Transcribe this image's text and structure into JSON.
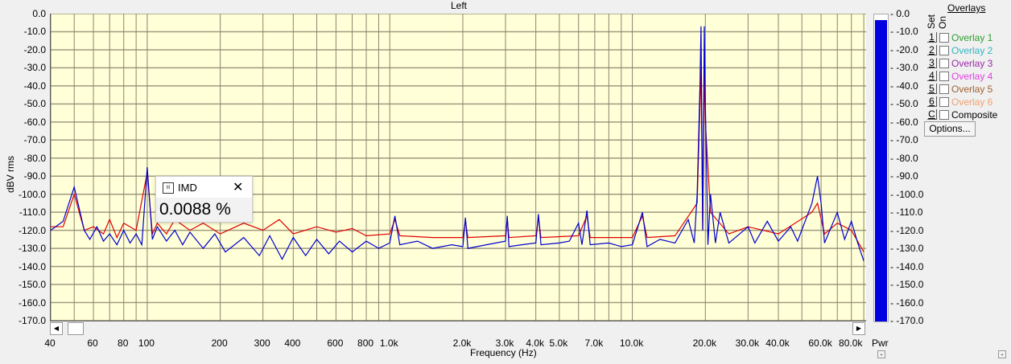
{
  "window": {
    "title": "Left"
  },
  "chart_data": {
    "type": "line",
    "title": "Left",
    "xlabel": "Frequency (Hz)",
    "ylabel": "dBV rms",
    "xscale": "log",
    "xlim": [
      40,
      92000
    ],
    "ylim": [
      -170,
      0
    ],
    "grid": true,
    "background": "#ffffd8",
    "yticks": [
      "0.0",
      "-10.0",
      "-20.0",
      "-30.0",
      "-40.0",
      "-50.0",
      "-60.0",
      "-70.0",
      "-80.0",
      "-90.0",
      "-100.0",
      "-110.0",
      "-120.0",
      "-130.0",
      "-140.0",
      "-150.0",
      "-160.0",
      "-170.0"
    ],
    "xticks": [
      {
        "v": 40,
        "l": "40"
      },
      {
        "v": 60,
        "l": "60"
      },
      {
        "v": 80,
        "l": "80"
      },
      {
        "v": 100,
        "l": "100"
      },
      {
        "v": 200,
        "l": "200"
      },
      {
        "v": 300,
        "l": "300"
      },
      {
        "v": 400,
        "l": "400"
      },
      {
        "v": 600,
        "l": "600"
      },
      {
        "v": 800,
        "l": "800"
      },
      {
        "v": 1000,
        "l": "1.0k"
      },
      {
        "v": 2000,
        "l": "2.0k"
      },
      {
        "v": 3000,
        "l": "3.0k"
      },
      {
        "v": 4000,
        "l": "4.0k"
      },
      {
        "v": 5000,
        "l": "5.0k"
      },
      {
        "v": 7000,
        "l": "7.0k"
      },
      {
        "v": 10000,
        "l": "10.0k"
      },
      {
        "v": 20000,
        "l": "20.0k"
      },
      {
        "v": 30000,
        "l": "30.0k"
      },
      {
        "v": 40000,
        "l": "40.0k"
      },
      {
        "v": 60000,
        "l": "60.0k"
      },
      {
        "v": 80000,
        "l": "80.0k"
      }
    ],
    "series": [
      {
        "color": "#e00000",
        "points": [
          [
            40,
            -118
          ],
          [
            45,
            -118
          ],
          [
            50,
            -100
          ],
          [
            55,
            -120
          ],
          [
            60,
            -118
          ],
          [
            66,
            -122
          ],
          [
            70,
            -114
          ],
          [
            75,
            -124
          ],
          [
            80,
            -116
          ],
          [
            90,
            -120
          ],
          [
            100,
            -88
          ],
          [
            105,
            -122
          ],
          [
            110,
            -116
          ],
          [
            120,
            -122
          ],
          [
            130,
            -114
          ],
          [
            150,
            -120
          ],
          [
            170,
            -116
          ],
          [
            200,
            -122
          ],
          [
            250,
            -116
          ],
          [
            300,
            -120
          ],
          [
            350,
            -114
          ],
          [
            400,
            -122
          ],
          [
            500,
            -118
          ],
          [
            600,
            -121
          ],
          [
            700,
            -119
          ],
          [
            800,
            -123
          ],
          [
            1000,
            -122
          ],
          [
            1050,
            -114
          ],
          [
            1100,
            -123
          ],
          [
            1500,
            -124
          ],
          [
            2000,
            -124
          ],
          [
            2050,
            -115
          ],
          [
            2100,
            -124
          ],
          [
            3000,
            -123
          ],
          [
            3050,
            -114
          ],
          [
            3100,
            -124
          ],
          [
            4000,
            -123
          ],
          [
            4100,
            -113
          ],
          [
            4200,
            -124
          ],
          [
            6000,
            -123
          ],
          [
            6500,
            -112
          ],
          [
            6700,
            -124
          ],
          [
            10000,
            -124
          ],
          [
            11000,
            -112
          ],
          [
            11500,
            -124
          ],
          [
            15000,
            -123
          ],
          [
            18500,
            -105
          ],
          [
            19200,
            -30
          ],
          [
            19500,
            -120
          ],
          [
            19800,
            -30
          ],
          [
            20000,
            -60
          ],
          [
            21000,
            -110
          ],
          [
            25000,
            -122
          ],
          [
            30000,
            -118
          ],
          [
            40000,
            -122
          ],
          [
            55000,
            -110
          ],
          [
            58000,
            -105
          ],
          [
            62000,
            -122
          ],
          [
            70000,
            -116
          ],
          [
            80000,
            -120
          ],
          [
            90000,
            -132
          ]
        ]
      },
      {
        "color": "#0000d0",
        "points": [
          [
            40,
            -120
          ],
          [
            45,
            -115
          ],
          [
            50,
            -96
          ],
          [
            55,
            -120
          ],
          [
            58,
            -125
          ],
          [
            62,
            -118
          ],
          [
            66,
            -126
          ],
          [
            70,
            -122
          ],
          [
            75,
            -128
          ],
          [
            80,
            -120
          ],
          [
            85,
            -127
          ],
          [
            90,
            -122
          ],
          [
            95,
            -128
          ],
          [
            100,
            -85
          ],
          [
            105,
            -125
          ],
          [
            110,
            -118
          ],
          [
            120,
            -126
          ],
          [
            130,
            -120
          ],
          [
            140,
            -128
          ],
          [
            150,
            -121
          ],
          [
            170,
            -130
          ],
          [
            190,
            -122
          ],
          [
            210,
            -132
          ],
          [
            250,
            -124
          ],
          [
            290,
            -134
          ],
          [
            320,
            -123
          ],
          [
            360,
            -136
          ],
          [
            400,
            -124
          ],
          [
            450,
            -134
          ],
          [
            500,
            -125
          ],
          [
            560,
            -133
          ],
          [
            620,
            -126
          ],
          [
            700,
            -132
          ],
          [
            800,
            -126
          ],
          [
            900,
            -130
          ],
          [
            1000,
            -127
          ],
          [
            1050,
            -112
          ],
          [
            1100,
            -128
          ],
          [
            1300,
            -126
          ],
          [
            1500,
            -130
          ],
          [
            1800,
            -128
          ],
          [
            2000,
            -129
          ],
          [
            2050,
            -113
          ],
          [
            2100,
            -130
          ],
          [
            2500,
            -128
          ],
          [
            3000,
            -126
          ],
          [
            3050,
            -112
          ],
          [
            3100,
            -129
          ],
          [
            3500,
            -128
          ],
          [
            4000,
            -127
          ],
          [
            4100,
            -111
          ],
          [
            4200,
            -128
          ],
          [
            5000,
            -127
          ],
          [
            5500,
            -126
          ],
          [
            6000,
            -116
          ],
          [
            6200,
            -128
          ],
          [
            6500,
            -109
          ],
          [
            6700,
            -128
          ],
          [
            8000,
            -127
          ],
          [
            9000,
            -129
          ],
          [
            10000,
            -128
          ],
          [
            11000,
            -110
          ],
          [
            11500,
            -129
          ],
          [
            13000,
            -125
          ],
          [
            15000,
            -127
          ],
          [
            17000,
            -114
          ],
          [
            18000,
            -127
          ],
          [
            18500,
            -100
          ],
          [
            19000,
            -40
          ],
          [
            19200,
            -7
          ],
          [
            19500,
            -120
          ],
          [
            19800,
            -7
          ],
          [
            20000,
            -50
          ],
          [
            20500,
            -128
          ],
          [
            21000,
            -100
          ],
          [
            22000,
            -127
          ],
          [
            23000,
            -110
          ],
          [
            25000,
            -127
          ],
          [
            30000,
            -118
          ],
          [
            32000,
            -127
          ],
          [
            36000,
            -115
          ],
          [
            40000,
            -126
          ],
          [
            45000,
            -118
          ],
          [
            48000,
            -126
          ],
          [
            55000,
            -105
          ],
          [
            58000,
            -90
          ],
          [
            60000,
            -105
          ],
          [
            62000,
            -127
          ],
          [
            70000,
            -110
          ],
          [
            75000,
            -125
          ],
          [
            80000,
            -115
          ],
          [
            85000,
            -127
          ],
          [
            90000,
            -137
          ]
        ]
      }
    ]
  },
  "meter": {
    "label": "Pwr",
    "level_dbv": -3,
    "color": "#0000e0",
    "ticks": [
      "0.0",
      "-10.0",
      "-20.0",
      "-30.0",
      "-40.0",
      "-50.0",
      "-60.0",
      "-70.0",
      "-80.0",
      "-90.0",
      "-100.0",
      "-110.0",
      "-120.0",
      "-130.0",
      "-140.0",
      "-150.0",
      "-160.0",
      "-170.0"
    ]
  },
  "overlays": {
    "title": "Overlays",
    "set_label": "Set",
    "on_label": "On",
    "items": [
      {
        "set": "1",
        "label": "Overlay 1",
        "color": "#2e9e2e",
        "on": false
      },
      {
        "set": "2",
        "label": "Overlay 2",
        "color": "#33b5c0",
        "on": false
      },
      {
        "set": "3",
        "label": "Overlay 3",
        "color": "#9a2aa8",
        "on": false
      },
      {
        "set": "4",
        "label": "Overlay 4",
        "color": "#e040e0",
        "on": false
      },
      {
        "set": "5",
        "label": "Overlay 5",
        "color": "#a06030",
        "on": false
      },
      {
        "set": "6",
        "label": "Overlay 6",
        "color": "#f0a070",
        "on": false
      },
      {
        "set": "C",
        "label": "Composite",
        "color": "#000000",
        "on": false
      }
    ],
    "options_label": "Options..."
  },
  "popup": {
    "title": "IMD",
    "value": "0.0088 %"
  }
}
